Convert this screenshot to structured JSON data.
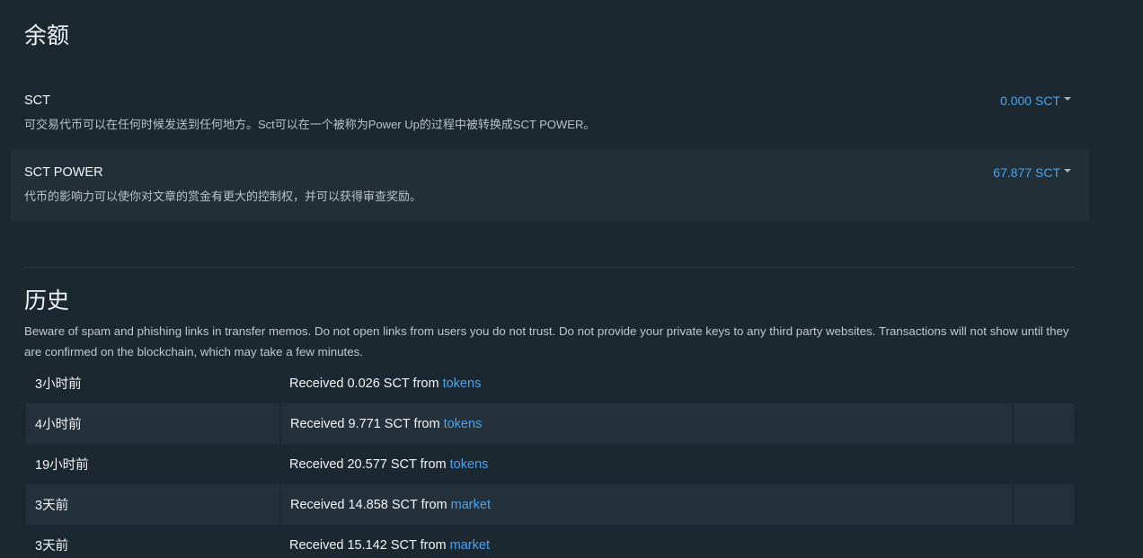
{
  "balances": {
    "heading": "余额",
    "items": [
      {
        "name": "SCT",
        "description": "可交易代币可以在任何时候发送到任何地方。Sct可以在一个被称为Power Up的过程中被转换成SCT POWER。",
        "value": "0.000 SCT"
      },
      {
        "name": "SCT POWER",
        "description": "代币的影响力可以使你对文章的赏金有更大的控制权，并可以获得审查奖励。",
        "value": "67.877 SCT"
      }
    ]
  },
  "history": {
    "heading": "历史",
    "warning": "Beware of spam and phishing links in transfer memos. Do not open links from users you do not trust. Do not provide your private keys to any third party websites. Transactions will not show until they are confirmed on the blockchain, which may take a few minutes.",
    "rows": [
      {
        "time": "3小时前",
        "text": "Received 0.026 SCT from ",
        "account": "tokens"
      },
      {
        "time": "4小时前",
        "text": "Received 9.771 SCT from ",
        "account": "tokens"
      },
      {
        "time": "19小时前",
        "text": "Received 20.577 SCT from ",
        "account": "tokens"
      },
      {
        "time": "3天前",
        "text": "Received 14.858 SCT from ",
        "account": "market"
      },
      {
        "time": "3天前",
        "text": "Received 15.142 SCT from ",
        "account": "market"
      }
    ]
  },
  "colors": {
    "background": "#1c2830",
    "row_shade": "#24313a",
    "link": "#4aa3f0"
  }
}
